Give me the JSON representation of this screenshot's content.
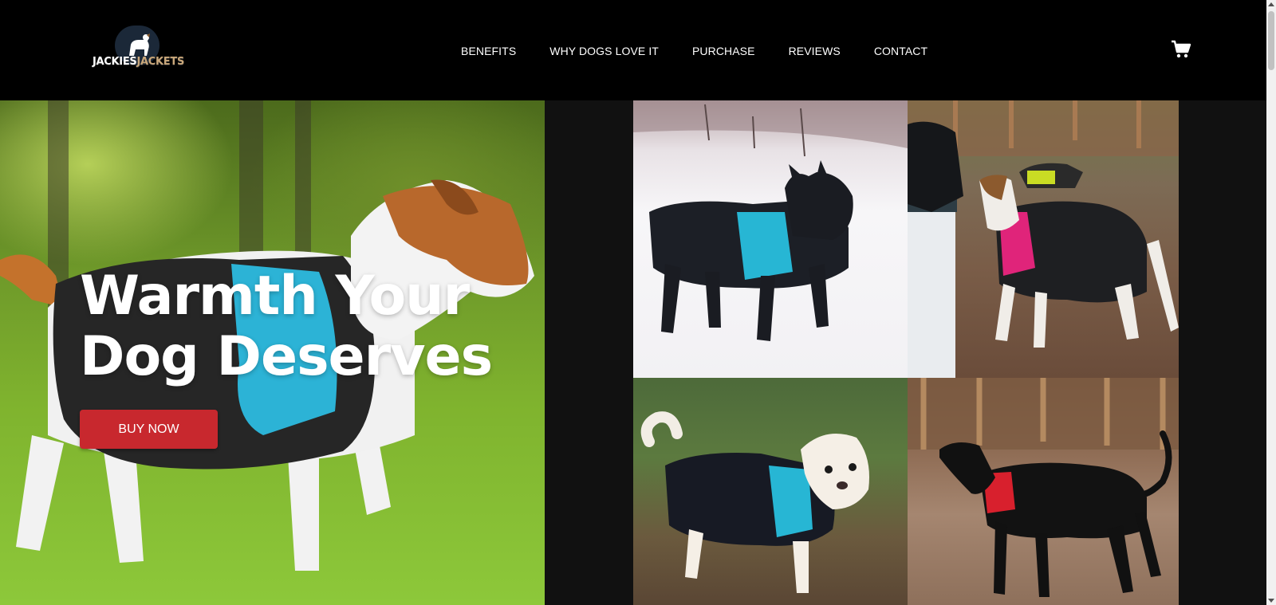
{
  "brand": {
    "name_part1": "JACKIES",
    "name_part2": "JACKETS",
    "accent_color": "#c9a77a"
  },
  "nav": {
    "items": [
      {
        "label": "BENEFITS"
      },
      {
        "label": "WHY DOGS LOVE IT"
      },
      {
        "label": "PURCHASE"
      },
      {
        "label": "REVIEWS"
      },
      {
        "label": "CONTACT"
      }
    ],
    "cart_icon": "shopping-cart-icon"
  },
  "hero": {
    "title_line1": "Warmth Your",
    "title_line2": "Dog Deserves",
    "cta_label": "BUY NOW",
    "cta_color": "#c8282e"
  },
  "gallery": {
    "photos": [
      {
        "subject": "black french bulldog in blue jacket on snow"
      },
      {
        "subject": "hound in black and pink jacket"
      },
      {
        "subject": "small white dog in black and blue jacket"
      },
      {
        "subject": "black dog in black and red jacket"
      }
    ]
  }
}
